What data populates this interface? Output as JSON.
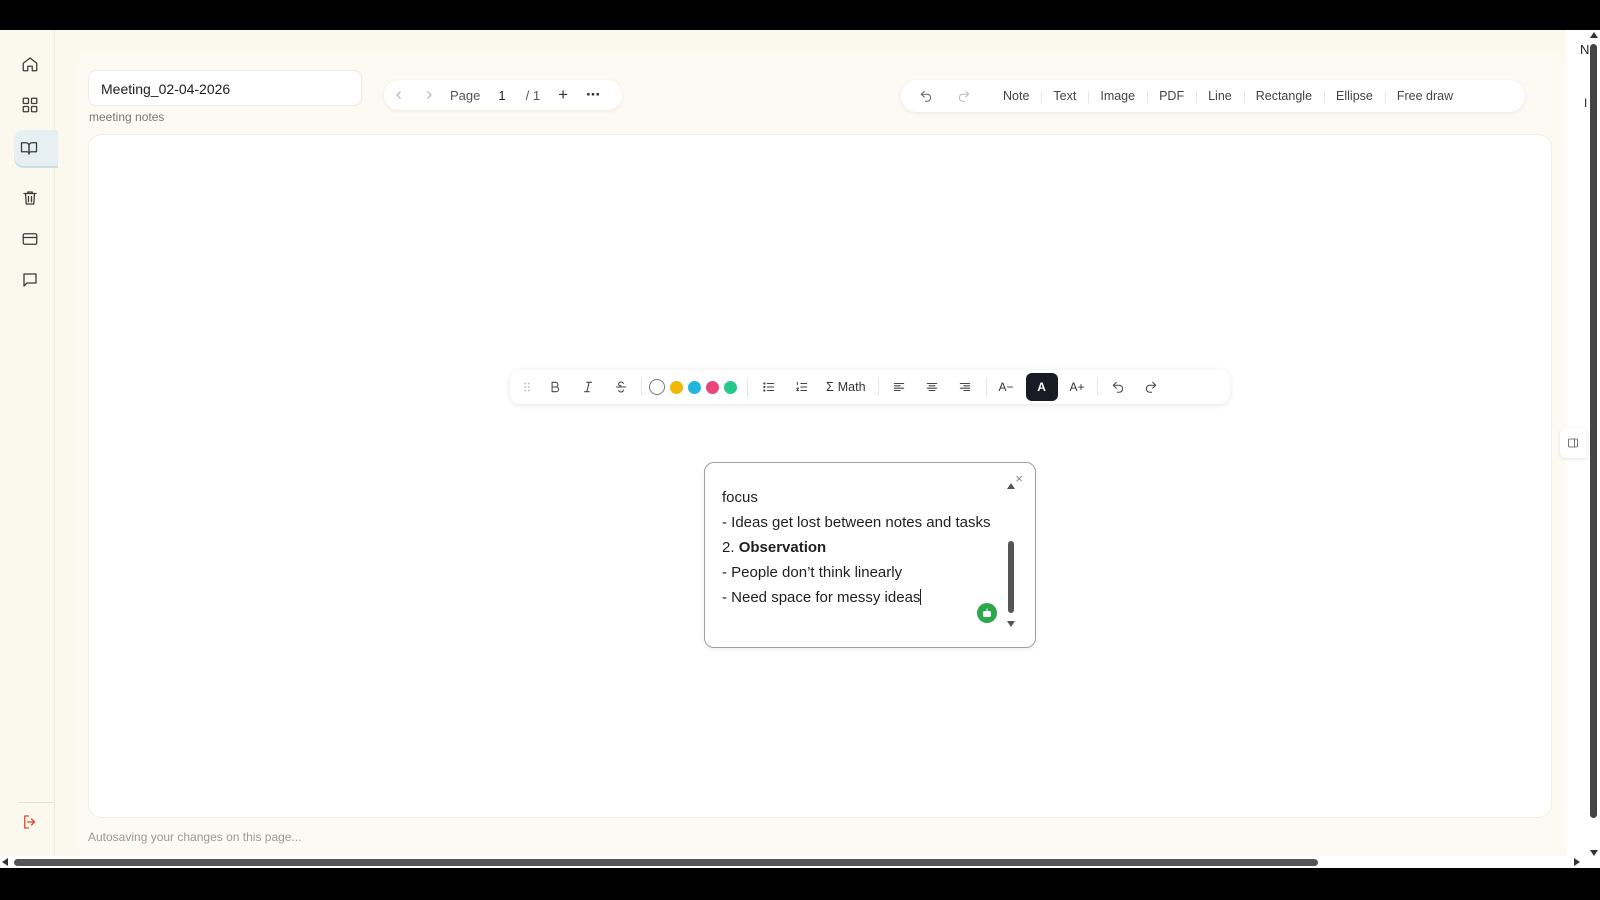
{
  "sidebar": {
    "items": [
      {
        "icon": "home-icon"
      },
      {
        "icon": "dashboard-icon"
      },
      {
        "icon": "notebook-icon",
        "active": true
      },
      {
        "icon": "trash-icon"
      },
      {
        "icon": "card-icon"
      },
      {
        "icon": "message-icon"
      }
    ],
    "logout_icon": "logout-icon",
    "accent_color": "#e6f0f3",
    "logout_color": "#e0442d"
  },
  "document": {
    "title": "Meeting_02-04-2026",
    "subtitle": "meeting notes"
  },
  "pager": {
    "page_label": "Page",
    "current_page": "1",
    "total_pages": "/ 1",
    "add": "+",
    "more": "···"
  },
  "tools": {
    "items": [
      "Note",
      "Text",
      "Image",
      "PDF",
      "Line",
      "Rectangle",
      "Ellipse",
      "Free draw"
    ]
  },
  "format_toolbar": {
    "math_label": "Math",
    "math_symbol": "Σ",
    "font_smaller": "A−",
    "font_current": "A",
    "font_larger": "A+",
    "colors": [
      "#ffffff",
      "#f2b705",
      "#1fb6e0",
      "#e8457a",
      "#25c98a"
    ]
  },
  "note": {
    "line1": "focus",
    "line2": "- Ideas get lost between notes and tasks",
    "line3_prefix": "2. ",
    "line3_bold": "Observation",
    "line4": "- People don’t think linearly",
    "line5": "- Need space for messy ideas",
    "close": "×",
    "badge_color": "#2aa84a"
  },
  "status": {
    "autosave": "Autosaving your changes on this page..."
  },
  "rail": {
    "letter": "N",
    "letter2": "I"
  }
}
